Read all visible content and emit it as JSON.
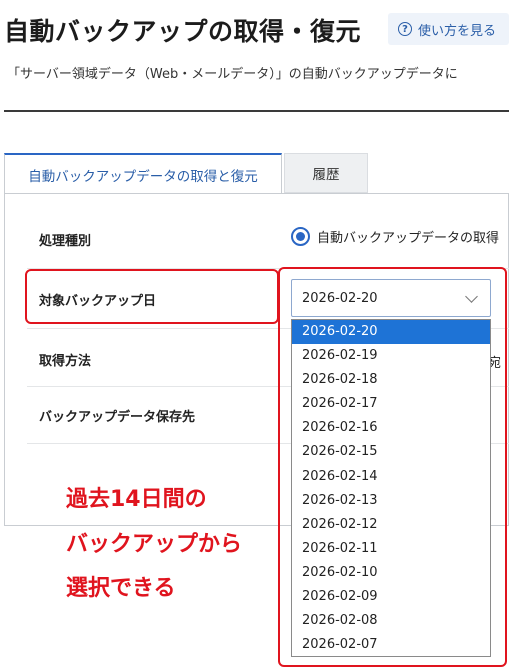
{
  "header": {
    "title": "自動バックアップの取得・復元",
    "help_button_label": "使い方を見る"
  },
  "description": "「サーバー領域データ（Web・メールデータ）」の自動バックアップデータに",
  "tabs": [
    {
      "label": "自動バックアップデータの取得と復元",
      "active": true
    },
    {
      "label": "履歴",
      "active": false
    }
  ],
  "form": {
    "process_type": {
      "label": "処理種別",
      "radio_label": "自動バックアップデータの取得",
      "selected": true
    },
    "backup_date": {
      "label": "対象バックアップ日",
      "value": "2026-02-20"
    },
    "acquire_method": {
      "label": "取得方法",
      "truncated_text": "宛"
    },
    "backup_destination": {
      "label": "バックアップデータ保存先"
    }
  },
  "dropdown": {
    "selected_index": 0,
    "options": [
      "2026-02-20",
      "2026-02-19",
      "2026-02-18",
      "2026-02-17",
      "2026-02-16",
      "2026-02-15",
      "2026-02-14",
      "2026-02-13",
      "2026-02-12",
      "2026-02-11",
      "2026-02-10",
      "2026-02-09",
      "2026-02-08",
      "2026-02-07"
    ]
  },
  "annotation": {
    "lines": [
      "過去14日間の",
      "バックアップから",
      "選択できる"
    ],
    "color": "#e0141e"
  },
  "colors": {
    "accent": "#2a66c4",
    "selected_option": "#1e73d6",
    "highlight": "#e0141e"
  }
}
